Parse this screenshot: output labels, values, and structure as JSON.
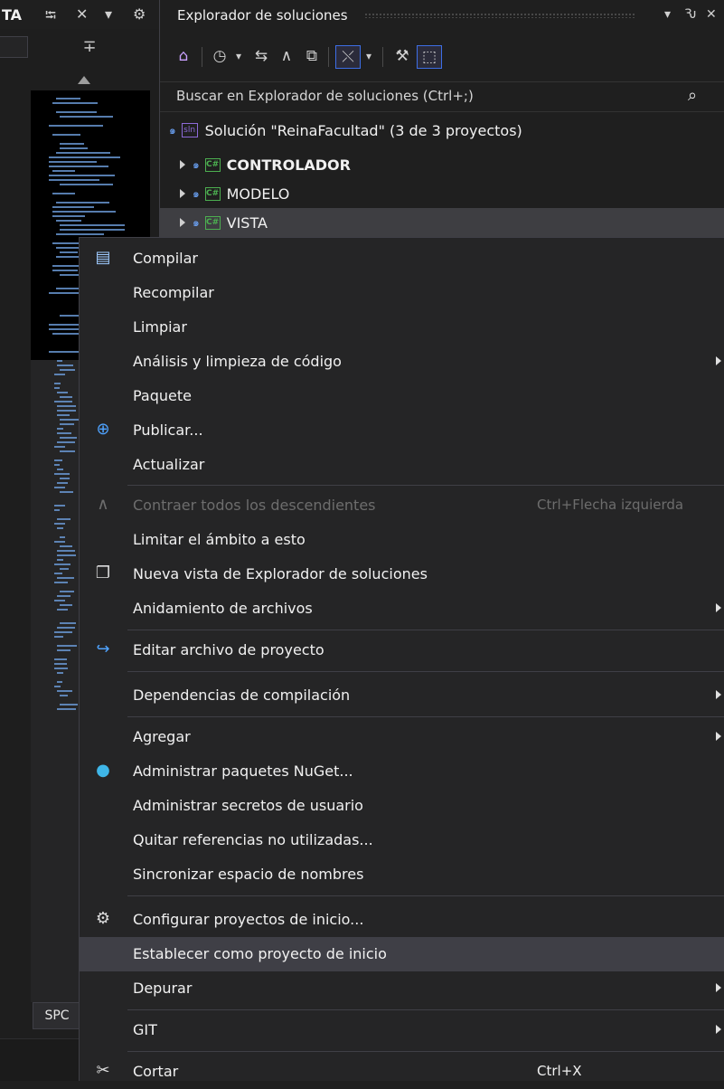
{
  "left_panel": {
    "tab_fragment": "TA",
    "pin_glyph": "⭾",
    "close_glyph": "✕",
    "dropdown_glyph": "▾",
    "gear_glyph": "⚙",
    "splitter_glyph": "∓",
    "bottom_tab": "SPC"
  },
  "solution_explorer": {
    "title": "Explorador de soluciones",
    "title_controls": {
      "dropdown": "▾",
      "pin": "Ԅ",
      "close": "✕"
    },
    "toolbar_glyphs": {
      "home": "⌂",
      "history": "◷",
      "history_drop": "▾",
      "sync": "⇆",
      "collapse": "∧",
      "copy": "⧉",
      "show_all": "⤬",
      "show_all_drop": "▾",
      "properties": "⚒",
      "preview": "⬚"
    },
    "search_placeholder": "Buscar en Explorador de soluciones (Ctrl+;)",
    "search_glyph": "⌕",
    "solution_badge": "sln",
    "solution_label": "Solución \"ReinaFacultad\" (3 de 3 proyectos)",
    "lock_glyph": "๑",
    "cs_badge": "C#",
    "projects": [
      {
        "name": "CONTROLADOR",
        "bold": true
      },
      {
        "name": "MODELO",
        "bold": false
      },
      {
        "name": "VISTA",
        "bold": false,
        "selected": true
      }
    ]
  },
  "context_menu": {
    "icon_glyphs": {
      "compile": "▤",
      "publish": "⊕",
      "collapse": "∧",
      "new_view": "❐",
      "edit": "↪",
      "nuget": "●",
      "gear": "⚙",
      "cut": "✂"
    },
    "items": [
      {
        "label": "Compilar",
        "icon": "build-icon"
      },
      {
        "label": "Recompilar"
      },
      {
        "label": "Limpiar"
      },
      {
        "label": "Análisis y limpieza de código",
        "submenu": true
      },
      {
        "label": "Paquete"
      },
      {
        "label": "Publicar...",
        "icon": "publish-globe-icon"
      },
      {
        "label": "Actualizar"
      },
      {
        "label": "Contraer todos los descendientes",
        "shortcut": "Ctrl+Flecha izquierda",
        "disabled": true,
        "icon": "collapse-icon"
      },
      {
        "label": "Limitar el ámbito a esto"
      },
      {
        "label": "Nueva vista de Explorador de soluciones",
        "icon": "new-view-icon"
      },
      {
        "label": "Anidamiento de archivos",
        "submenu": true
      },
      {
        "label": "Editar archivo de proyecto",
        "icon": "edit-project-icon"
      },
      {
        "label": "Dependencias de compilación",
        "submenu": true
      },
      {
        "label": "Agregar",
        "submenu": true
      },
      {
        "label": "Administrar paquetes NuGet...",
        "icon": "nuget-icon"
      },
      {
        "label": "Administrar secretos de usuario"
      },
      {
        "label": "Quitar referencias no utilizadas..."
      },
      {
        "label": "Sincronizar espacio de nombres"
      },
      {
        "label": "Configurar proyectos de inicio...",
        "icon": "gear-icon"
      },
      {
        "label": "Establecer como proyecto de inicio",
        "highlighted": true
      },
      {
        "label": "Depurar",
        "submenu": true
      },
      {
        "label": "GIT",
        "submenu": true
      },
      {
        "label": "Cortar",
        "shortcut": "Ctrl+X",
        "icon": "scissors-icon"
      }
    ]
  },
  "colors": {
    "background": "#1f1f1f",
    "menu_bg": "#252526",
    "highlight": "#3f3f46",
    "accent_blue": "#3d6ee6",
    "cs_green": "#4caf50"
  }
}
